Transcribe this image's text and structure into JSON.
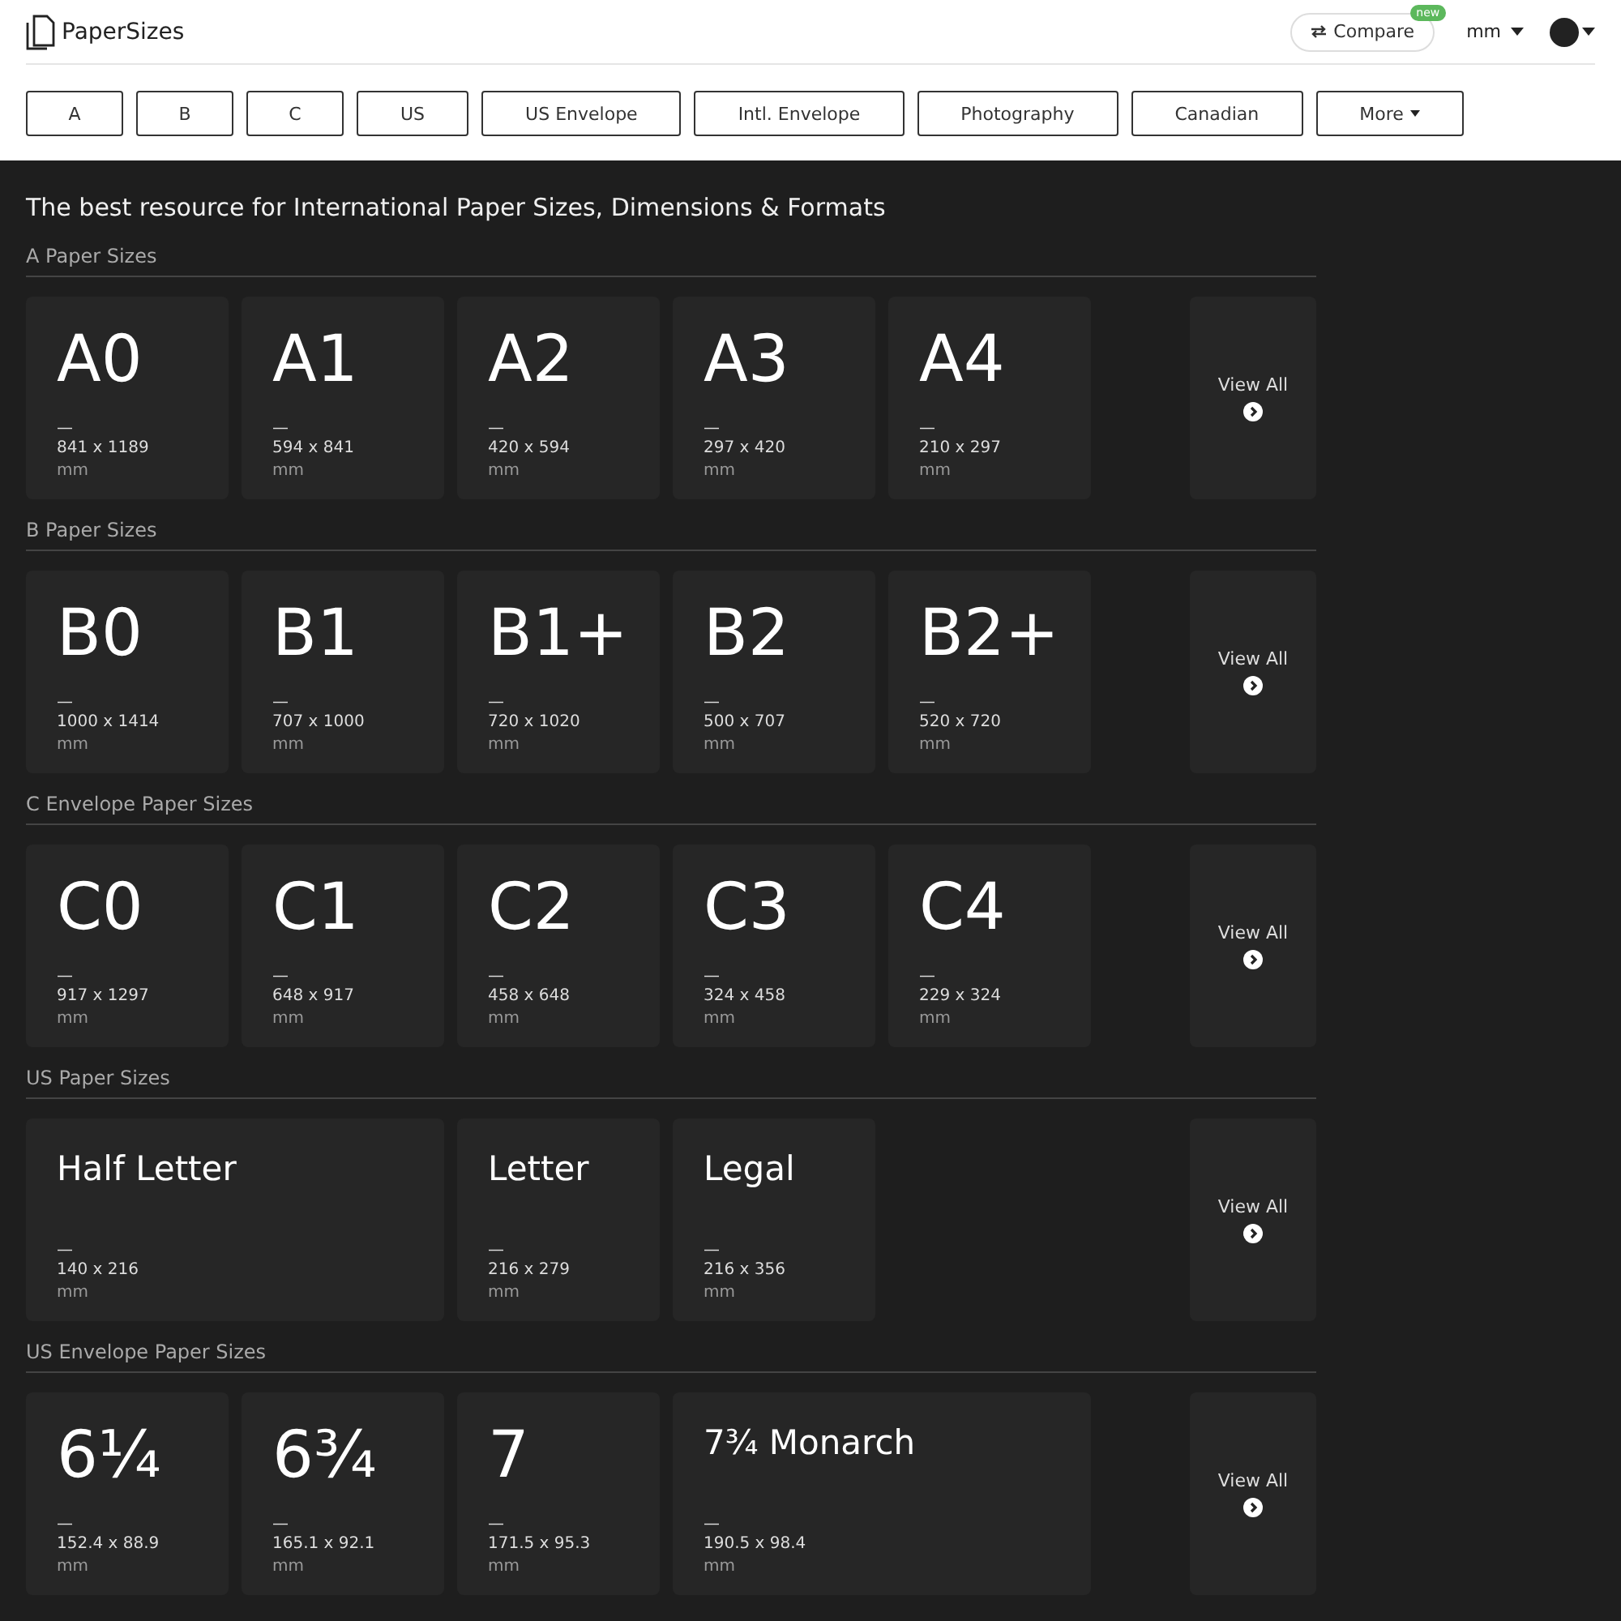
{
  "header": {
    "logo": "PaperSizes",
    "compare": {
      "label": "Compare",
      "badge": "new"
    },
    "unit": "mm",
    "dark_theme": true
  },
  "nav": [
    {
      "label": "A",
      "dropdown": false
    },
    {
      "label": "B",
      "dropdown": false
    },
    {
      "label": "C",
      "dropdown": false
    },
    {
      "label": "US",
      "dropdown": false
    },
    {
      "label": "US Envelope",
      "dropdown": false
    },
    {
      "label": "Intl. Envelope",
      "dropdown": false
    },
    {
      "label": "Photography",
      "dropdown": false
    },
    {
      "label": "Canadian",
      "dropdown": false
    },
    {
      "label": "More",
      "dropdown": true
    }
  ],
  "headline": "The best resource for International Paper Sizes, Dimensions & Formats",
  "sections": [
    {
      "title": "A Paper Sizes",
      "view_all": "View All",
      "cards": [
        {
          "name": "A0",
          "kind": "code",
          "wide": false,
          "dash": "—",
          "size": "841 x 1189",
          "unit": "mm"
        },
        {
          "name": "A1",
          "kind": "code",
          "wide": false,
          "dash": "—",
          "size": "594 x 841",
          "unit": "mm"
        },
        {
          "name": "A2",
          "kind": "code",
          "wide": false,
          "dash": "—",
          "size": "420 x 594",
          "unit": "mm"
        },
        {
          "name": "A3",
          "kind": "code",
          "wide": false,
          "dash": "—",
          "size": "297 x 420",
          "unit": "mm"
        },
        {
          "name": "A4",
          "kind": "code",
          "wide": false,
          "dash": "—",
          "size": "210 x 297",
          "unit": "mm"
        }
      ]
    },
    {
      "title": "B Paper Sizes",
      "view_all": "View All",
      "cards": [
        {
          "name": "B0",
          "kind": "code",
          "wide": false,
          "dash": "—",
          "size": "1000 x 1414",
          "unit": "mm"
        },
        {
          "name": "B1",
          "kind": "code",
          "wide": false,
          "dash": "—",
          "size": "707 x 1000",
          "unit": "mm"
        },
        {
          "name": "B1+",
          "kind": "code",
          "wide": false,
          "dash": "—",
          "size": "720 x 1020",
          "unit": "mm"
        },
        {
          "name": "B2",
          "kind": "code",
          "wide": false,
          "dash": "—",
          "size": "500 x 707",
          "unit": "mm"
        },
        {
          "name": "B2+",
          "kind": "code",
          "wide": false,
          "dash": "—",
          "size": "520 x 720",
          "unit": "mm"
        }
      ]
    },
    {
      "title": "C Envelope Paper Sizes",
      "view_all": "View All",
      "cards": [
        {
          "name": "C0",
          "kind": "code",
          "wide": false,
          "dash": "—",
          "size": "917 x 1297",
          "unit": "mm"
        },
        {
          "name": "C1",
          "kind": "code",
          "wide": false,
          "dash": "—",
          "size": "648 x 917",
          "unit": "mm"
        },
        {
          "name": "C2",
          "kind": "code",
          "wide": false,
          "dash": "—",
          "size": "458 x 648",
          "unit": "mm"
        },
        {
          "name": "C3",
          "kind": "code",
          "wide": false,
          "dash": "—",
          "size": "324 x 458",
          "unit": "mm"
        },
        {
          "name": "C4",
          "kind": "code",
          "wide": false,
          "dash": "—",
          "size": "229 x 324",
          "unit": "mm"
        }
      ]
    },
    {
      "title": "US Paper Sizes",
      "view_all": "View All",
      "cards": [
        {
          "name": "Half Letter",
          "kind": "name",
          "wide": true,
          "dash": "—",
          "size": "140 x 216",
          "unit": "mm"
        },
        {
          "name": "Letter",
          "kind": "name",
          "wide": false,
          "dash": "—",
          "size": "216 x 279",
          "unit": "mm"
        },
        {
          "name": "Legal",
          "kind": "name",
          "wide": false,
          "dash": "—",
          "size": "216 x 356",
          "unit": "mm"
        }
      ]
    },
    {
      "title": "US Envelope Paper Sizes",
      "view_all": "View All",
      "cards": [
        {
          "name": "6¼",
          "kind": "code",
          "wide": false,
          "dash": "—",
          "size": "152.4 x 88.9",
          "unit": "mm"
        },
        {
          "name": "6¾",
          "kind": "code",
          "wide": false,
          "dash": "—",
          "size": "165.1 x 92.1",
          "unit": "mm"
        },
        {
          "name": "7",
          "kind": "code",
          "wide": false,
          "dash": "—",
          "size": "171.5 x 95.3",
          "unit": "mm"
        },
        {
          "name": "7¾ Monarch",
          "kind": "name",
          "wide": true,
          "dash": "—",
          "size": "190.5 x 98.4",
          "unit": "mm"
        }
      ]
    }
  ]
}
